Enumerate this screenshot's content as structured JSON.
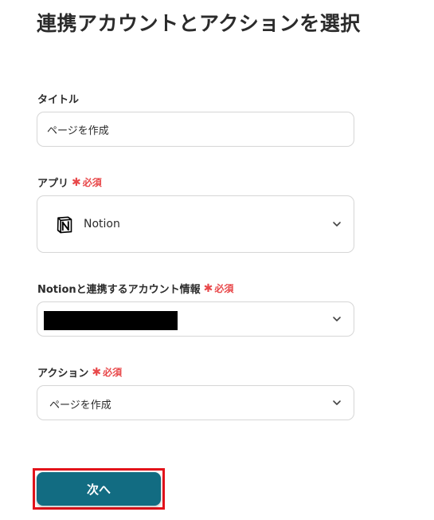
{
  "page": {
    "title": "連携アカウントとアクションを選択"
  },
  "form": {
    "title_field": {
      "label": "タイトル",
      "value": "ページを作成"
    },
    "app_field": {
      "label": "アプリ",
      "required": "必須",
      "value": "Notion",
      "icon": "notion-logo"
    },
    "account_field": {
      "label": "Notionと連携するアカウント情報",
      "required": "必須",
      "value_redacted": true
    },
    "action_field": {
      "label": "アクション",
      "required": "必須",
      "value": "ページを作成"
    }
  },
  "buttons": {
    "next_label": "次へ"
  },
  "colors": {
    "required": "#e8484a",
    "primary_button": "#126c82",
    "highlight_outline": "#e3131b"
  }
}
